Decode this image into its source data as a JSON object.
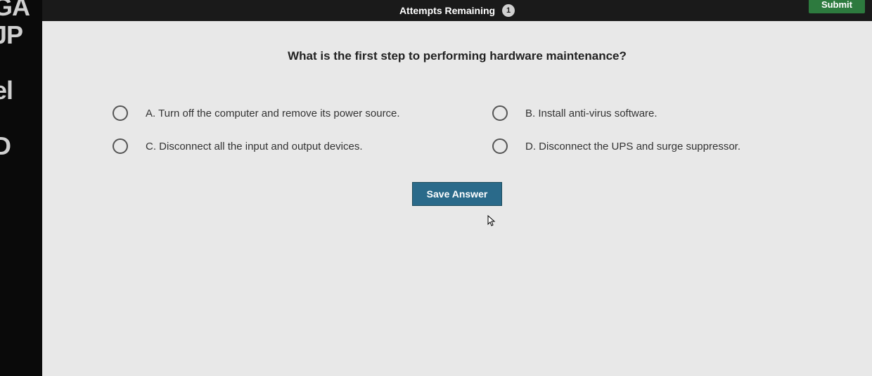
{
  "sidebar": {
    "text_fragments": "GA\nJP\n\nel\n\nD\nl"
  },
  "header": {
    "attempts_label": "Attempts Remaining",
    "attempts_count": "1",
    "submit_label": "Submit"
  },
  "question": {
    "prompt": "What is the first step to performing hardware maintenance?"
  },
  "options": [
    {
      "key": "A",
      "text": "A. Turn off the computer and remove its power source."
    },
    {
      "key": "B",
      "text": "B. Install anti-virus software."
    },
    {
      "key": "C",
      "text": "C. Disconnect all the input and output devices."
    },
    {
      "key": "D",
      "text": "D. Disconnect the UPS and surge suppressor."
    }
  ],
  "actions": {
    "save_label": "Save Answer"
  }
}
